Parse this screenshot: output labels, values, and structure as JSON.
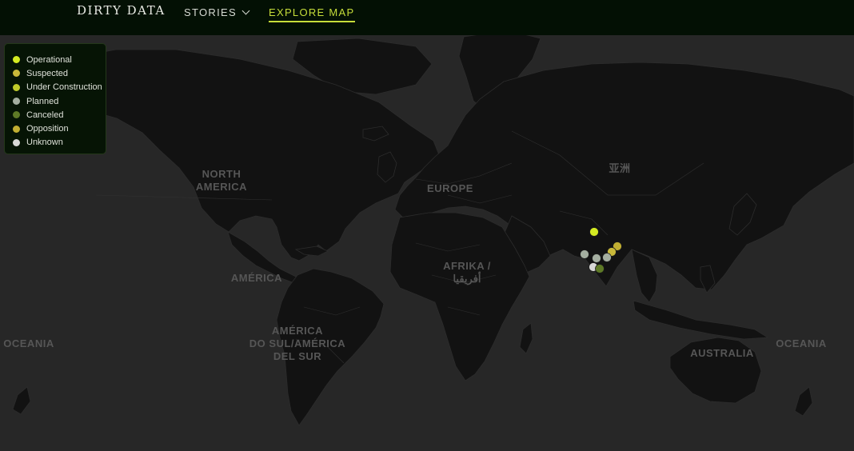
{
  "header": {
    "brand": "DIRTY DATA",
    "nav": {
      "stories_label": "STORIES",
      "explore_label": "EXPLORE MAP"
    }
  },
  "legend": {
    "items": [
      {
        "label": "Operational",
        "color": "#d4ea22"
      },
      {
        "label": "Suspected",
        "color": "#c9b93a"
      },
      {
        "label": "Under Construction",
        "color": "#c0cb2a"
      },
      {
        "label": "Planned",
        "color": "#a4aea0"
      },
      {
        "label": "Canceled",
        "color": "#5e7a26"
      },
      {
        "label": "Opposition",
        "color": "#c2af32"
      },
      {
        "label": "Unknown",
        "color": "#d8d8d6"
      }
    ]
  },
  "map": {
    "labels": {
      "north_america_1": "NORTH",
      "north_america_2": "AMERICA",
      "america": "AMÉRICA",
      "south_america_1": "AMÉRICA",
      "south_america_2": "DO SUL/AMÉRICA",
      "south_america_3": "DEL SUR",
      "europe": "EUROPE",
      "asia": "亚洲",
      "africa_1": "AFRIKA /",
      "africa_2": "أفريقيا",
      "australia": "AUSTRALIA",
      "oceania_left": "OCEANIA",
      "oceania_right": "OCEANIA"
    },
    "points": [
      {
        "status": "Operational"
      },
      {
        "status": "Opposition"
      },
      {
        "status": "Suspected"
      },
      {
        "status": "Planned"
      },
      {
        "status": "Planned"
      },
      {
        "status": "Planned"
      },
      {
        "status": "Unknown"
      },
      {
        "status": "Canceled"
      }
    ]
  }
}
